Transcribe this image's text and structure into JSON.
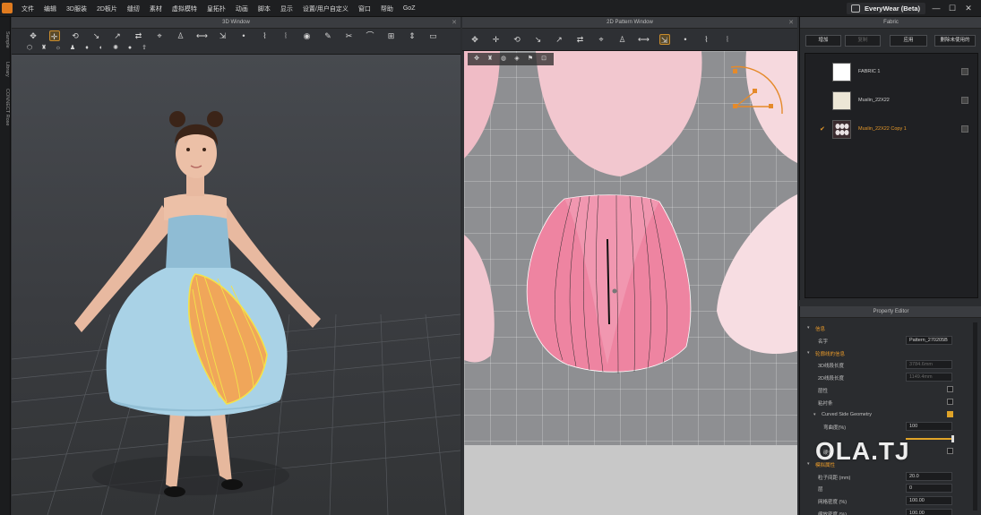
{
  "menu": {
    "items": [
      "文件",
      "编辑",
      "3D服装",
      "2D板片",
      "缝纫",
      "素材",
      "虚拟模特",
      "皇拓扑",
      "动画",
      "脚本",
      "显示",
      "设置/用户自定义",
      "窗口",
      "帮助",
      "GoZ"
    ]
  },
  "brand": {
    "label": "EveryWear (Beta)"
  },
  "window_controls": {
    "minimize": "—",
    "maximize": "☐",
    "close": "✕"
  },
  "side_tabs": [
    "Sample",
    "Library",
    "CONNECT Rose"
  ],
  "window_3d": {
    "title": "3D Window"
  },
  "window_2d": {
    "title": "2D Pattern Window"
  },
  "fabric_panel": {
    "title": "Fabric",
    "buttons": [
      {
        "label": "增加",
        "enabled": true
      },
      {
        "label": "复制",
        "enabled": false
      },
      {
        "label": "应用",
        "enabled": true
      },
      {
        "label": "删除未使用的",
        "enabled": true
      }
    ],
    "items": [
      {
        "name": "FABRIC 1",
        "color": "#ffffff",
        "selected": false
      },
      {
        "name": "Muslin_22X22",
        "color": "#ece6d6",
        "selected": false
      },
      {
        "name": "Muslin_22X22 Copy 1",
        "color": "#3a2a2e",
        "selected": true,
        "check": "✔"
      }
    ]
  },
  "property_editor": {
    "title": "Property Editor",
    "rows": [
      {
        "label": "信息",
        "type": "section"
      },
      {
        "label": "名字",
        "type": "value",
        "value": "Pattern_270205B"
      },
      {
        "label": "轮廓线的信息",
        "type": "section"
      },
      {
        "label": "3D线段长度",
        "type": "value",
        "value": "3784.6mm",
        "dim": true
      },
      {
        "label": "2D线段长度",
        "type": "value",
        "value": "1149.4mm",
        "dim": true
      },
      {
        "label": "层性",
        "type": "check",
        "checked": false
      },
      {
        "label": "粘衬条",
        "type": "check",
        "checked": false
      },
      {
        "label": "Curved Side Geometry",
        "type": "check",
        "checked": true,
        "sub": true
      },
      {
        "label": "弯曲度(%)",
        "type": "value",
        "value": "100",
        "sub2": true
      },
      {
        "label": "",
        "type": "slider",
        "level": 0.98
      },
      {
        "label": "硬化",
        "type": "check",
        "checked": false,
        "sub2": true
      },
      {
        "label": "模拟属性",
        "type": "section"
      },
      {
        "label": "粒子间距 (mm)",
        "type": "value",
        "value": "20.0"
      },
      {
        "label": "层",
        "type": "value",
        "value": "0"
      },
      {
        "label": "网格密度 (%)",
        "type": "value",
        "value": "100.00"
      },
      {
        "label": "缩放密度 (%)",
        "type": "value",
        "value": "100.00"
      }
    ]
  },
  "watermark": {
    "text": "OLA.TJ"
  },
  "colors": {
    "accent": "#e89a2a",
    "menubar": "#1e1f21",
    "panel": "#2a2c2f"
  },
  "toolbar_3d_icons": [
    "select-icon",
    "move-icon",
    "rotate-icon",
    "pin-icon",
    "fold-icon",
    "arrange-icon",
    "tack-icon",
    "avatar-icon",
    "measure-icon",
    "shrink-icon",
    "point-icon",
    "strap-icon",
    "zipper-icon",
    "button-icon",
    "brush-icon",
    "trim-icon",
    "sew-icon",
    "fit-icon",
    "stretch-icon",
    "pattern-icon"
  ],
  "toolbar_2d_icons": [
    "edit-pattern-icon",
    "transform-icon",
    "rect-icon",
    "polygon-icon",
    "circle-icon",
    "dart-icon",
    "curve-icon",
    "segment-sewing-icon",
    "free-sewing-icon",
    "fabric-texture-icon",
    "grain-icon",
    "topstitch-icon",
    "graphic-icon"
  ]
}
